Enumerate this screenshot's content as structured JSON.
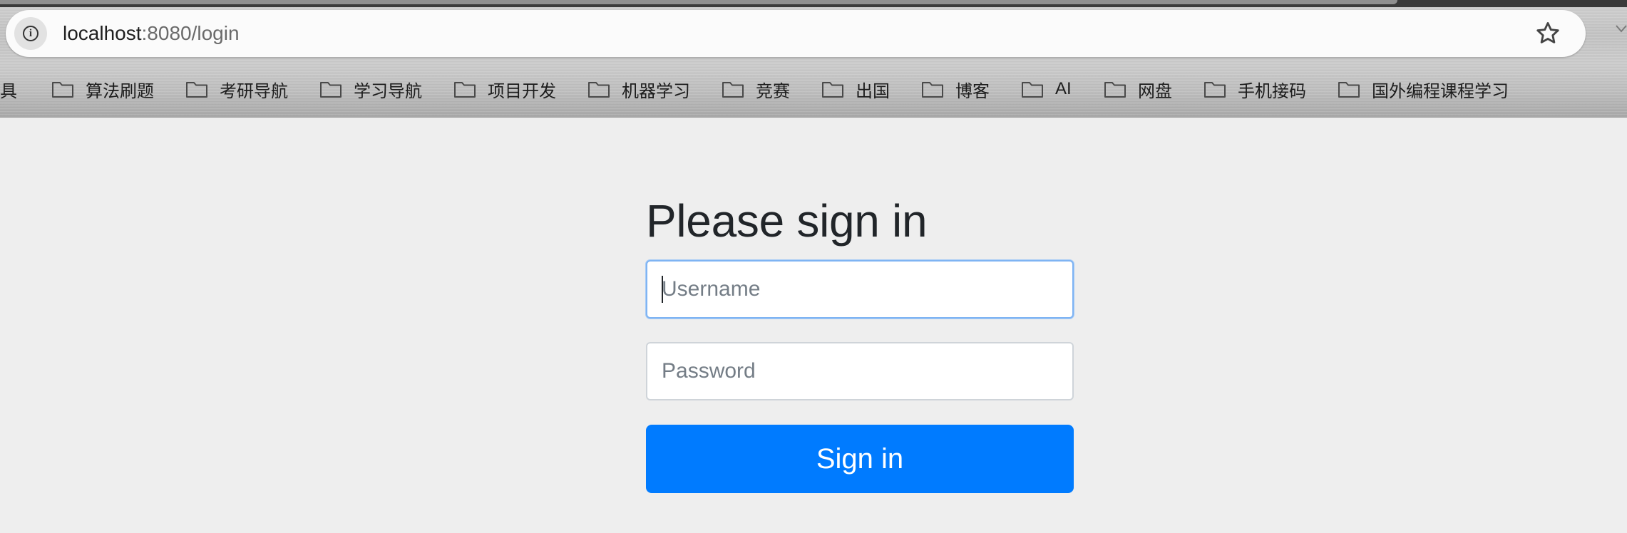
{
  "browser": {
    "url_host": "localhost",
    "url_path": ":8080/login",
    "bookmarks": [
      {
        "label": "工具"
      },
      {
        "label": "算法刷题"
      },
      {
        "label": "考研导航"
      },
      {
        "label": "学习导航"
      },
      {
        "label": "项目开发"
      },
      {
        "label": "机器学习"
      },
      {
        "label": "竞赛"
      },
      {
        "label": "出国"
      },
      {
        "label": "博客"
      },
      {
        "label": "AI"
      },
      {
        "label": "网盘"
      },
      {
        "label": "手机接码"
      },
      {
        "label": "国外编程课程学习"
      }
    ],
    "icons": {
      "site_info": "info-icon",
      "bookmark_star": "star-icon",
      "bookmark_folder": "folder-icon"
    }
  },
  "login": {
    "heading": "Please sign in",
    "username": {
      "value": "",
      "placeholder": "Username"
    },
    "password": {
      "value": "",
      "placeholder": "Password"
    },
    "submit_label": "Sign in"
  },
  "colors": {
    "page_background": "#eeeeee",
    "primary_button": "#007bff",
    "focus_border": "#7fb4f3",
    "heading_text": "#212529"
  }
}
